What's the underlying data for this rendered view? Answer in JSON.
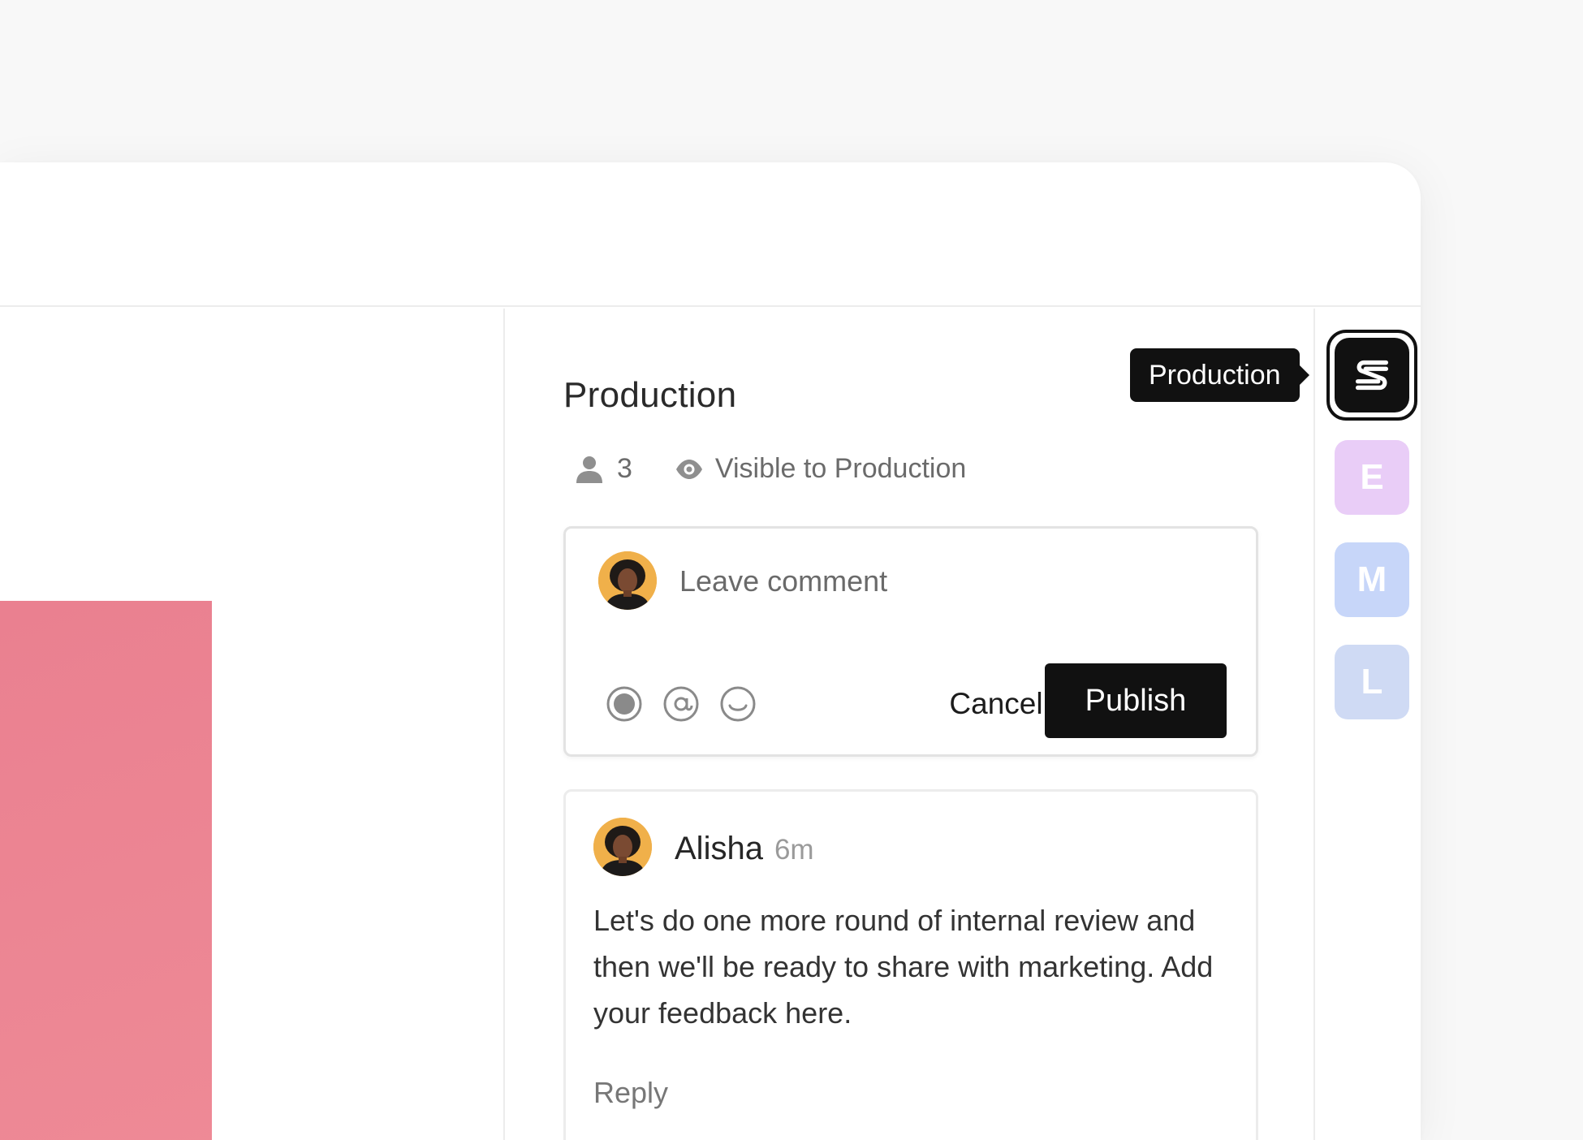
{
  "panel": {
    "title": "Production",
    "member_count": "3",
    "visibility": "Visible to Production"
  },
  "composer": {
    "placeholder": "Leave comment",
    "cancel_label": "Cancel",
    "publish_label": "Publish",
    "tools": [
      "record-icon",
      "mention-icon",
      "emoji-icon"
    ]
  },
  "comment": {
    "author": "Alisha",
    "time": "6m",
    "body": "Let's do one more round of internal review and then we'll be ready to share with marketing. Add your feedback here.",
    "reply_label": "Reply"
  },
  "rail": {
    "tooltip": "Production",
    "channels": [
      {
        "letter": "E",
        "color": "#e9cdf7"
      },
      {
        "letter": "M",
        "color": "#c7d6f9"
      },
      {
        "letter": "L",
        "color": "#cfdaf4"
      }
    ]
  },
  "colors": {
    "accent": "#111111",
    "canvas_shape": "#ea8090"
  }
}
